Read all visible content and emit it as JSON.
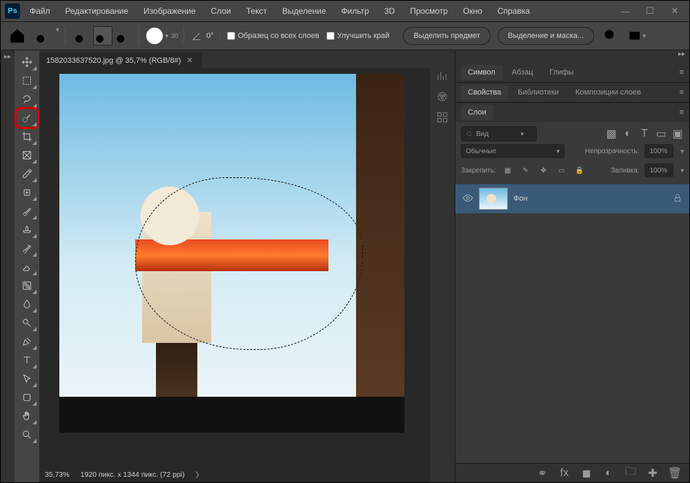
{
  "menu": {
    "items": [
      "Файл",
      "Редактирование",
      "Изображение",
      "Слои",
      "Текст",
      "Выделение",
      "Фильтр",
      "3D",
      "Просмотр",
      "Окно",
      "Справка"
    ]
  },
  "options": {
    "brush_size": "30",
    "angle_label": "0°",
    "sample_all_layers": "Образец со всех слоев",
    "refine_edge": "Улучшить край",
    "select_subject": "Выделить предмет",
    "select_and_mask": "Выделение и маска..."
  },
  "document": {
    "tab_title": "1582033637520.jpg @ 35,7% (RGB/8#)",
    "zoom": "35,73%",
    "dimensions": "1920 пикс. x 1344 пикс. (72 ppi)"
  },
  "panels": {
    "char_tabs": [
      "Символ",
      "Абзац",
      "Глифы"
    ],
    "prop_tabs": [
      "Свойства",
      "Библиотеки",
      "Композиции слоев"
    ],
    "layers_tabs": [
      "Слои"
    ],
    "filter_placeholder": "Вид",
    "blend_mode": "Обычные",
    "opacity_label": "Непрозрачность:",
    "opacity_value": "100%",
    "lock_label": "Закрепить:",
    "fill_label": "Заливка:",
    "fill_value": "100%",
    "layer_name": "Фон"
  },
  "colors": {
    "highlight": "#d40000"
  }
}
